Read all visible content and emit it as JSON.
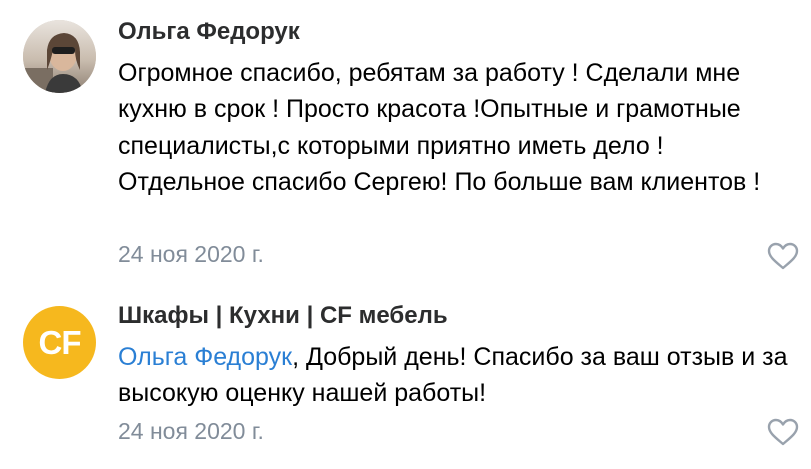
{
  "comments": [
    {
      "author": "Ольга Федорук",
      "text": "Огромное спасибо, ребятам за работу ! Сделали мне кухню в срок ! Просто красота !Опытные и грамотные специалисты,с которыми приятно иметь дело ! Отдельное спасибо Сергею! По больше вам клиентов !",
      "date": "24 ноя 2020 г.",
      "avatar_icon": "user-photo-avatar",
      "like_icon": "heart-outline-icon"
    },
    {
      "author": "Шкафы | Кухни | CF мебель",
      "mention": "Ольга Федорук",
      "text": ", Добрый день! Спасибо за ваш отзыв и за высокую оценку нашей работы!",
      "date": "24 ноя 2020 г.",
      "avatar_text": "CF",
      "avatar_color": "#f6b81e",
      "like_icon": "heart-outline-icon"
    }
  ],
  "colors": {
    "mention": "#2a7fd4",
    "date": "#818c99",
    "like": "#99a2ad"
  }
}
